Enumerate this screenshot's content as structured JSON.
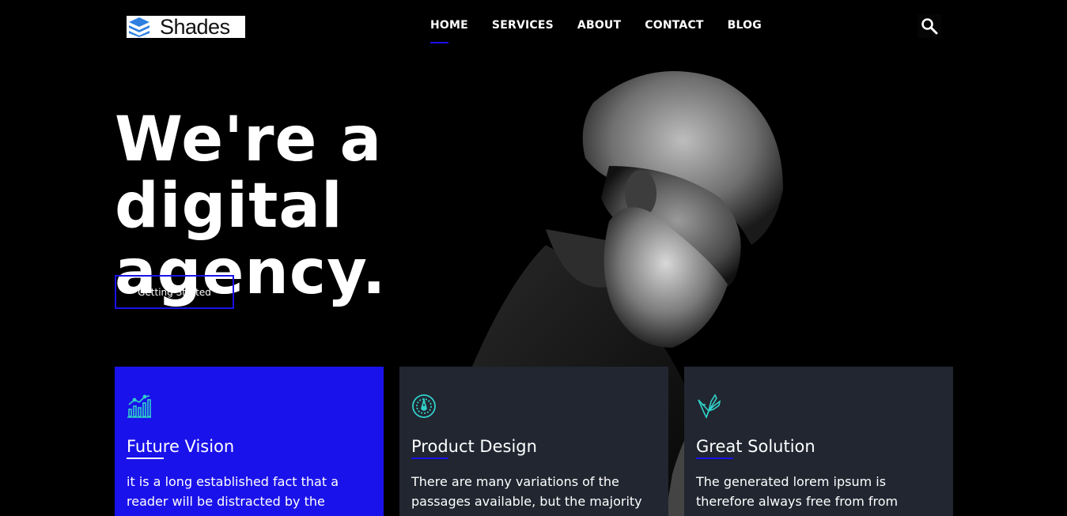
{
  "brand": {
    "name": "Shades",
    "accent": "#1a12ea",
    "card_bg": "#212631",
    "icon_color": "#31d0c8"
  },
  "nav": {
    "items": [
      {
        "label": "HOME",
        "active": true
      },
      {
        "label": "SERVICES",
        "active": false
      },
      {
        "label": "ABOUT",
        "active": false
      },
      {
        "label": "CONTACT",
        "active": false
      },
      {
        "label": "BLOG",
        "active": false
      }
    ],
    "search_icon": "search-icon"
  },
  "hero": {
    "title_line1": "We're a digital",
    "title_line2": "agency.",
    "cta_label": "Getting Started"
  },
  "features": [
    {
      "icon": "growth-chart-icon",
      "title": "Future Vision",
      "text": "it is a long established fact that a reader will be distracted by the"
    },
    {
      "icon": "gauge-icon",
      "title": "Product Design",
      "text": "There are many variations of the passages available, but the majority"
    },
    {
      "icon": "pen-tools-icon",
      "title": "Great Solution",
      "text": "The generated lorem ipsum is therefore always free from from"
    }
  ]
}
